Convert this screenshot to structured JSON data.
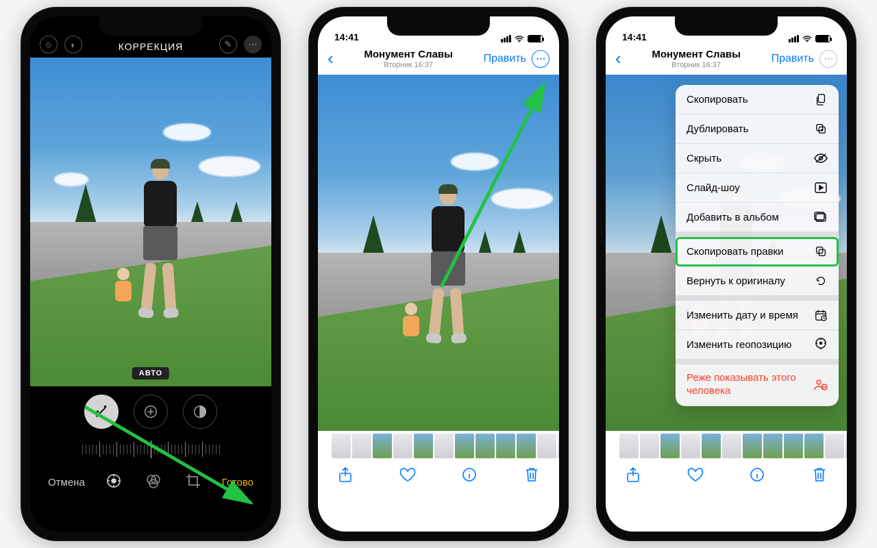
{
  "phone1": {
    "title": "КОРРЕКЦИЯ",
    "auto_badge": "АВТО",
    "cancel": "Отмена",
    "done": "Готово"
  },
  "phone2": {
    "time": "14:41",
    "place": "Монумент Славы",
    "subtitle": "Вторник 16:37",
    "edit": "Править"
  },
  "phone3": {
    "time": "14:41",
    "place": "Монумент Славы",
    "subtitle": "Вторник 16:37",
    "edit": "Править"
  },
  "menu": {
    "copy": "Скопировать",
    "duplicate": "Дублировать",
    "hide": "Скрыть",
    "slideshow": "Слайд-шоу",
    "add_album": "Добавить в альбом",
    "copy_edits": "Скопировать правки",
    "revert": "Вернуть к оригиналу",
    "change_date": "Изменить дату и время",
    "change_geo": "Изменить геопозицию",
    "less_person": "Реже показывать этого человека"
  }
}
